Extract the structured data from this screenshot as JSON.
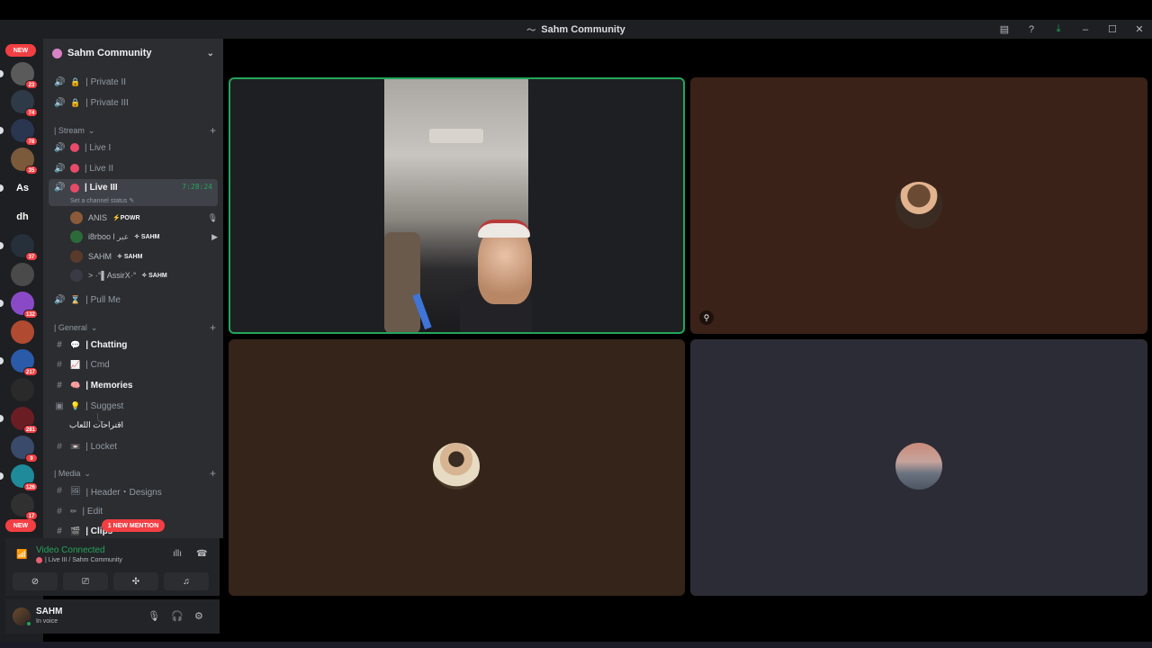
{
  "window": {
    "title": "Sahm Community"
  },
  "server": {
    "name": "Sahm Community"
  },
  "rail": {
    "new_label": "NEW",
    "servers": [
      {
        "label": "",
        "badge": "23",
        "color": "#5a5a5a"
      },
      {
        "label": "",
        "badge": "74",
        "color": "#2f3a48"
      },
      {
        "label": "",
        "badge": "78",
        "color": "#2a3550"
      },
      {
        "label": "",
        "badge": "35",
        "color": "#7a5a3a"
      },
      {
        "label": "As",
        "badge": "",
        "color": "#1e1f22"
      },
      {
        "label": "dh",
        "badge": "",
        "color": "#1e1f22"
      },
      {
        "label": "",
        "badge": "37",
        "color": "#26303a"
      },
      {
        "label": "",
        "badge": "",
        "color": "#4a4a4a"
      },
      {
        "label": "",
        "badge": "132",
        "color": "#8a4ac8"
      },
      {
        "label": "",
        "badge": "",
        "color": "#b04a30"
      },
      {
        "label": "",
        "badge": "217",
        "color": "#2a5aa8"
      },
      {
        "label": "",
        "badge": "",
        "color": "#2a2a2a"
      },
      {
        "label": "",
        "badge": "281",
        "color": "#6a1e24"
      },
      {
        "label": "",
        "badge": "9",
        "color": "#3a4a6a"
      },
      {
        "label": "",
        "badge": "126",
        "color": "#1e8a9a"
      },
      {
        "label": "",
        "badge": "17",
        "color": "#303030"
      }
    ]
  },
  "channels": {
    "private2": "| Private II",
    "private3": "| Private III",
    "cat_stream": "| Stream",
    "live1": "| Live I",
    "live2": "| Live II",
    "live3": "| Live III",
    "live3_timer": "7:28:24",
    "live3_status": "Set a channel status",
    "pull_me": "| Pull Me",
    "cat_general": "| General",
    "chatting": "| Chatting",
    "cmd": "| Cmd",
    "memories": "| Memories",
    "suggest": "| Suggest",
    "suggest_thread": "اقتراحات اللعاب",
    "locket": "| Locket",
    "cat_media": "| Media",
    "header_designs": "| Header・Designs",
    "edit": "| Edit",
    "clips": "| Clips"
  },
  "voice_users": [
    {
      "name": "ANIS",
      "tag": "⚡POWR",
      "icon": "🎙",
      "avatar": "#8a5a3a"
    },
    {
      "name": "i8rboo l عبر",
      "tag": "✧ SAHM",
      "icon": "▶",
      "avatar": "#2d6a3a"
    },
    {
      "name": "SAHM",
      "tag": "✧ SAHM",
      "icon": "",
      "avatar": "#5a3a2a"
    },
    {
      "name": "> ·°▌AssirX·°",
      "tag": "✧ SAHM",
      "icon": "",
      "avatar": "#3a3a44"
    }
  ],
  "mention_pill": "1 NEW MENTION",
  "voice": {
    "status": "Video Connected",
    "channel": "| Live III / Sahm Community"
  },
  "user": {
    "name": "SAHM",
    "status": "In voice"
  },
  "colors": {
    "accent_green": "#23a55a",
    "danger": "#f23f43",
    "sidebar": "#2b2d31"
  }
}
